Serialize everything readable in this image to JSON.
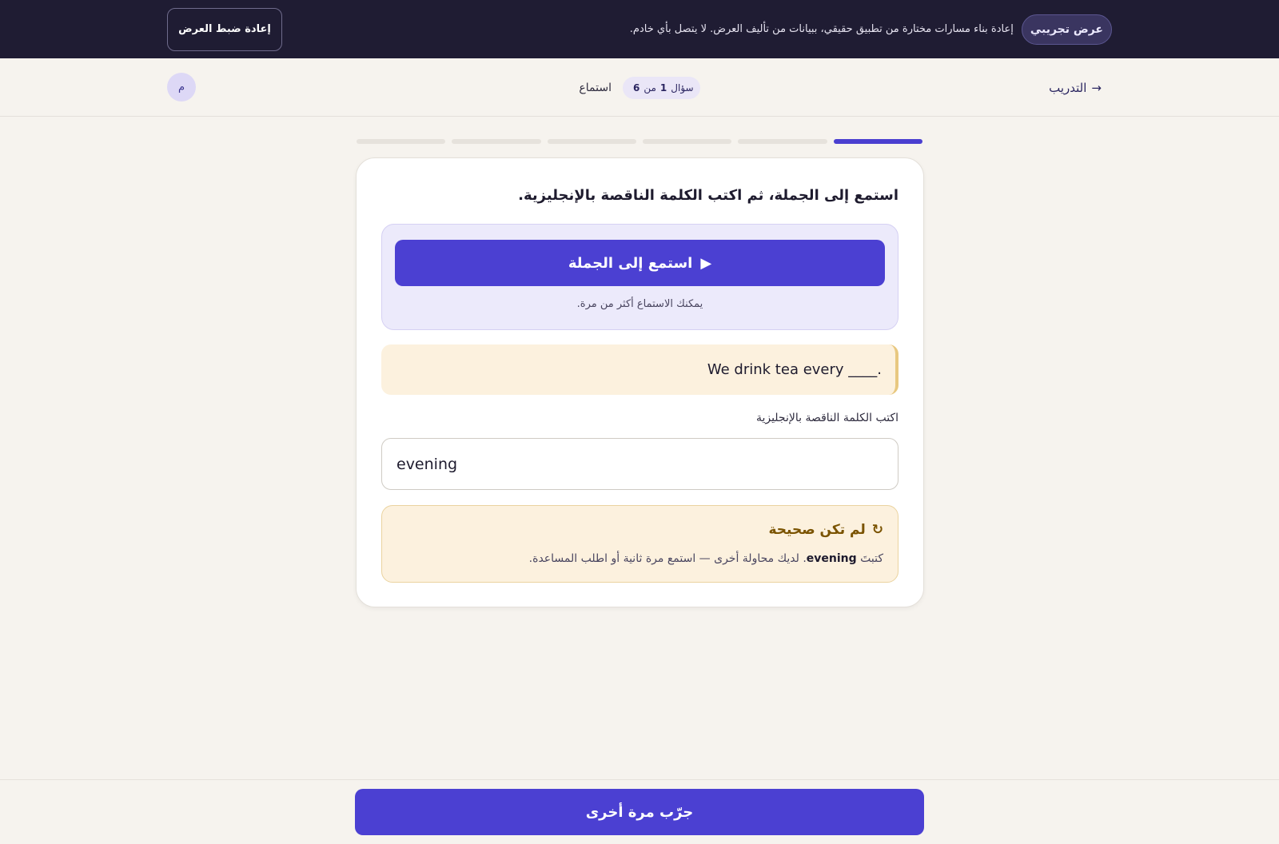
{
  "demo_banner": {
    "badge": "عرض تجريبي",
    "text": "إعادة بناء مسارات مختارة من تطبيق حقيقي، ببيانات من تأليف العرض. لا يتصل بأي خادم.",
    "reset_label": "إعادة ضبط العرض"
  },
  "nav": {
    "back_label": "التدريب",
    "back_arrow": "→",
    "counter_prefix": "سؤال",
    "counter_current": "1",
    "counter_sep": "من",
    "counter_total": "6",
    "mode_label": "استماع",
    "avatar_initial": "م"
  },
  "progress": {
    "total_steps": 6,
    "current_step": 1,
    "active_color": "#4a3fd0"
  },
  "question": {
    "instruction": "استمع إلى الجملة، ثم اكتب الكلمة الناقصة بالإنجليزية.",
    "listen_button": "استمع إلى الجملة",
    "play_icon": "▶",
    "listen_hint": "يمكنك الاستماع أكثر من مرة.",
    "sentence": "We drink tea every ____.",
    "field_label": "اكتب الكلمة الناقصة بالإنجليزية",
    "answer_value": "evening"
  },
  "feedback": {
    "icon": "↻",
    "title": "لم تكن صحيحة",
    "prefix": "كتبتَ",
    "answer": "evening",
    "message": ". لديك محاولة أخرى — استمع مرة ثانية أو اطلب المساعدة."
  },
  "footer": {
    "retry_label": "جرّب مرة أخرى"
  },
  "colors": {
    "primary": "#4b40d2",
    "dark_bar": "#1f1c33",
    "warning_bg": "#fcf1de",
    "warning_text": "#7a5300"
  }
}
